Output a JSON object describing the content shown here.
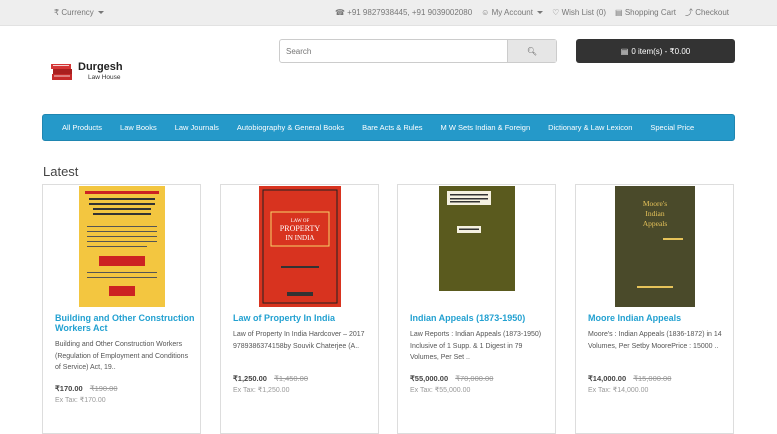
{
  "topbar": {
    "currency_label": "₹ Currency",
    "phone": "+91 9827938445, +91 9039002080",
    "account": "My Account",
    "wishlist": "Wish List (0)",
    "shopping_cart": "Shopping Cart",
    "checkout": "Checkout"
  },
  "logo": {
    "name": "Durgesh",
    "sub": "Law House"
  },
  "search": {
    "placeholder": "Search"
  },
  "cart": {
    "label": "0 item(s) - ₹0.00"
  },
  "menu": {
    "items": [
      "All Products",
      "Law Books",
      "Law Journals",
      "Autobiography & General Books",
      "Bare Acts & Rules",
      "M W Sets Indian & Foreign",
      "Dictionary & Law Lexicon",
      "Special Price"
    ]
  },
  "section_title": "Latest",
  "products": [
    {
      "title": "Building and Other Construction Workers Act",
      "desc": "Building and Other Construction Workers (Regulation of Employment and Conditions of Service) Act, 19..",
      "price": "₹170.00",
      "old_price": "₹190.00",
      "tax": "Ex Tax: ₹170.00",
      "cover_color": "#f3c640",
      "cover_text": "UNIVERSAL'S Building and Other Construction Workers (Regulation of Employment and Conditions of Service) Act, 1996"
    },
    {
      "title": "Law of Property In India",
      "desc": "Law of Property In India Hardcover – 2017 9789386374158by Souvik Chaterjee (A..",
      "price": "₹1,250.00",
      "old_price": "₹1,450.00",
      "tax": "Ex Tax: ₹1,250.00",
      "cover_color": "#d8331f",
      "cover_text": "LAW OF PROPERTY IN INDIA"
    },
    {
      "title": "Indian Appeals (1873-1950)",
      "desc": "Law Reports : Indian Appeals (1873-1950) Inclusive of 1 Supp. & 1 Digest in 79 Volumes, Per Set ..",
      "price": "₹55,000.00",
      "old_price": "₹70,000.00",
      "tax": "Ex Tax: ₹55,000.00",
      "cover_color": "#5a5a1e",
      "cover_text": "THE LAW REPORTS INDIAN APPEALS"
    },
    {
      "title": "Moore Indian Appeals",
      "desc": "Moore's : Indian Appeals (1836-1872) in 14 Volumes, Per Setby MoorePrice : 15000 ..",
      "price": "₹14,000.00",
      "old_price": "₹15,000.00",
      "tax": "Ex Tax: ₹14,000.00",
      "cover_color": "#4a4a2a",
      "cover_text": "Moore's Indian Appeals"
    }
  ]
}
